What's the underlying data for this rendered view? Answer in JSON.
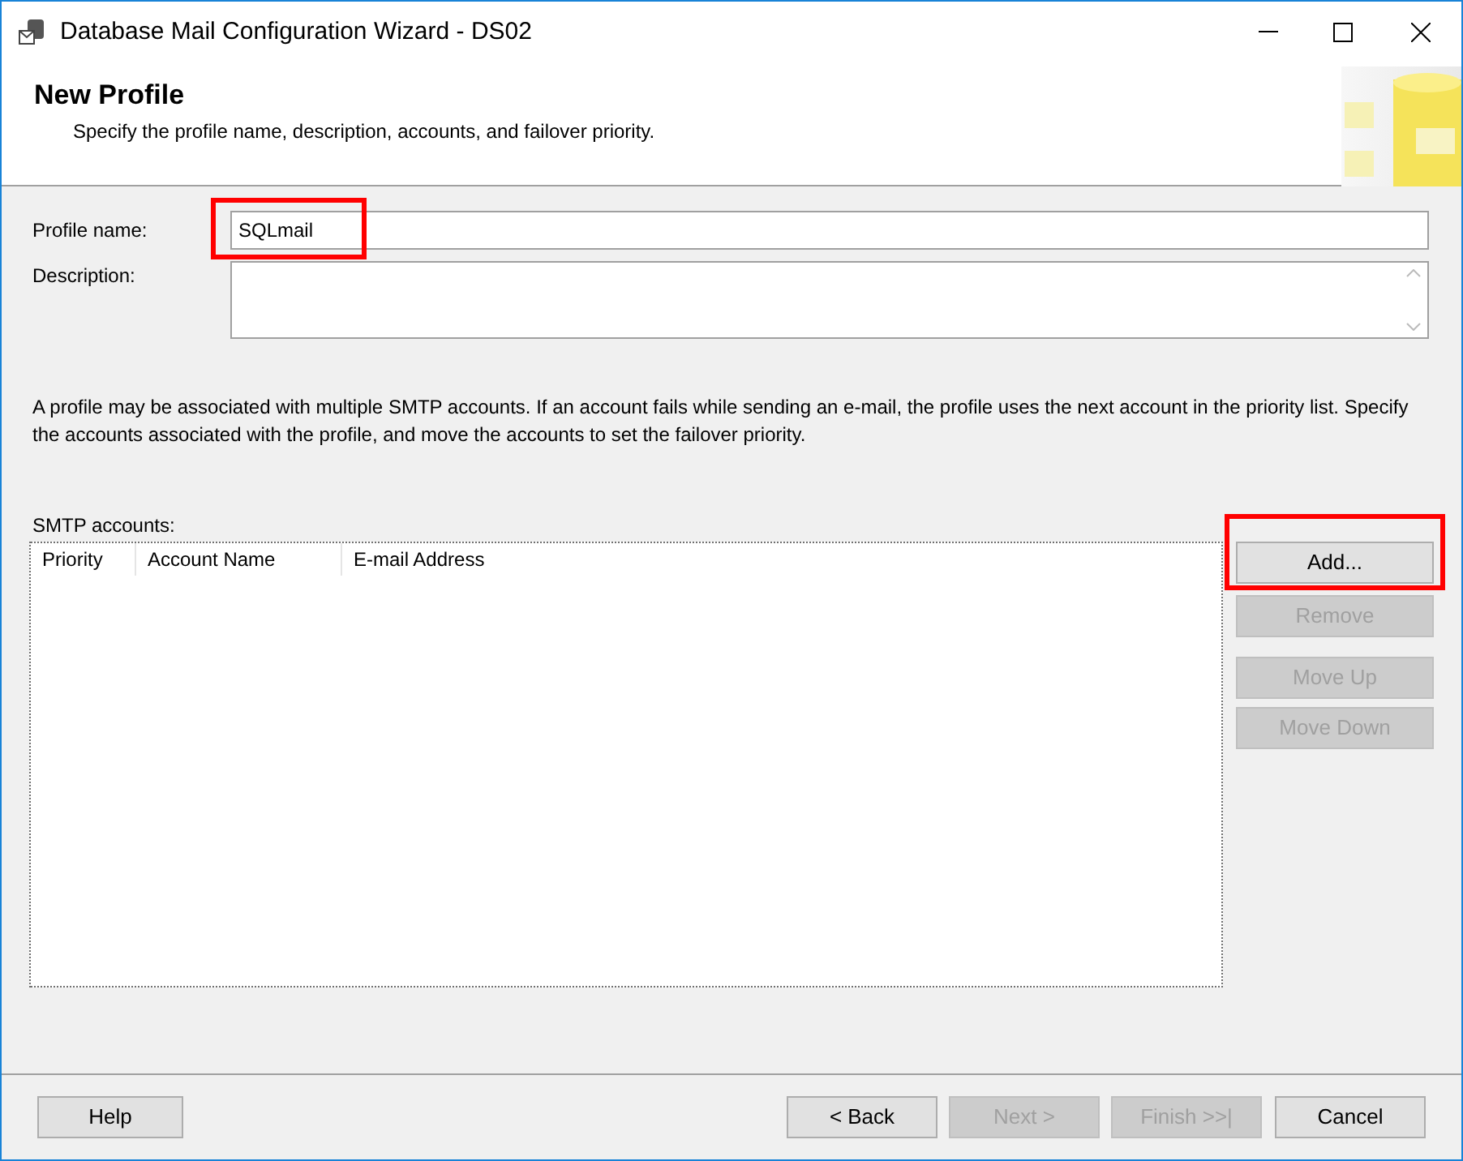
{
  "window": {
    "title": "Database Mail Configuration Wizard - DS02"
  },
  "header": {
    "title": "New Profile",
    "subtitle": "Specify the profile name, description, accounts, and failover priority."
  },
  "profile_name": {
    "label": "Profile name:",
    "value": "SQLmail",
    "highlighted": true
  },
  "description": {
    "label": "Description:"
  },
  "info": "A profile may be associated with multiple SMTP accounts. If an account fails while sending an e-mail, the profile uses the next account in the priority list. Specify the accounts associated with the profile, and move the accounts to set the failover priority.",
  "smtp": {
    "label": "SMTP accounts:",
    "columns": [
      "Priority",
      "Account Name",
      "E-mail Address"
    ]
  },
  "side_buttons": [
    {
      "label": "Add...",
      "disabled": false,
      "highlighted": true
    },
    {
      "label": "Remove",
      "disabled": true,
      "highlighted": false
    },
    {
      "label": "Move Up",
      "disabled": true,
      "highlighted": false
    },
    {
      "label": "Move Down",
      "disabled": true,
      "highlighted": false
    }
  ],
  "footer_buttons": [
    {
      "label": "Help",
      "disabled": false
    },
    {
      "label": "< Back",
      "disabled": false
    },
    {
      "label": "Next >",
      "disabled": true
    },
    {
      "label": "Finish >>|",
      "disabled": true
    },
    {
      "label": "Cancel",
      "disabled": false
    }
  ]
}
